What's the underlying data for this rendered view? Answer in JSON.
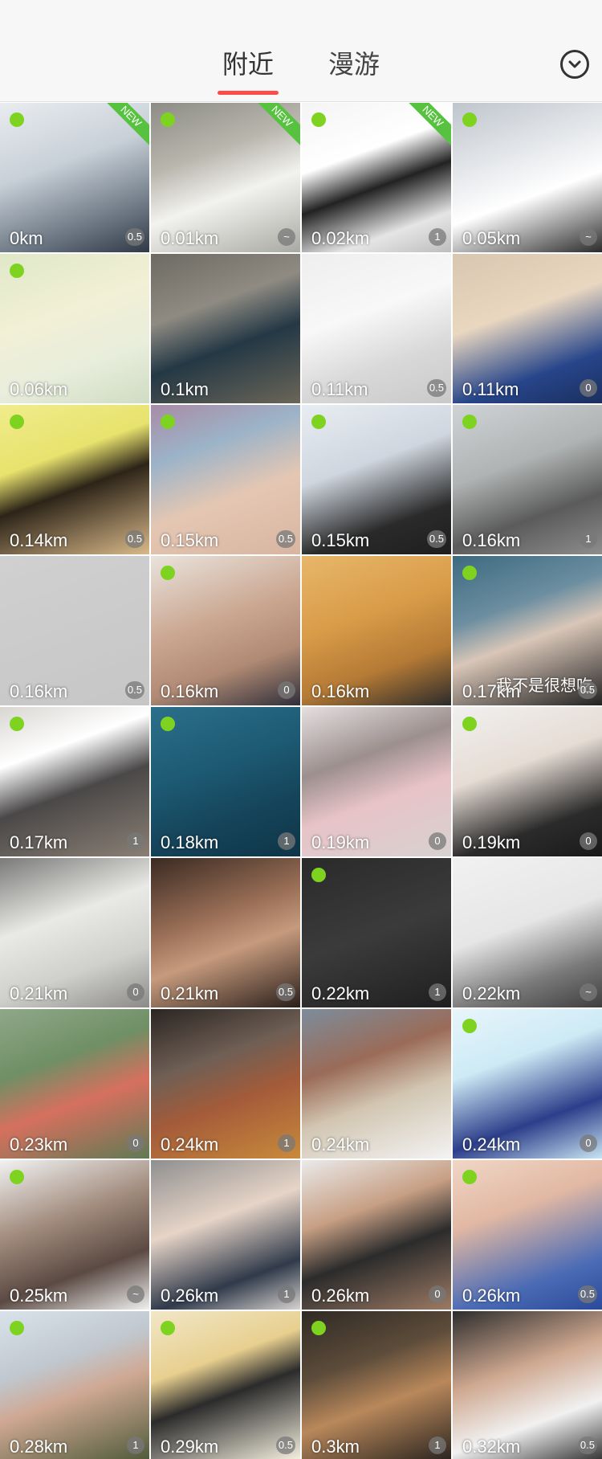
{
  "header": {
    "tabs": [
      {
        "label": "附近",
        "active": true
      },
      {
        "label": "漫游",
        "active": false
      }
    ],
    "dropdown_icon": "chevron-down-circle-icon"
  },
  "colors": {
    "online": "#7ed321",
    "new_tag": "#56c240",
    "tab_underline": "#ff4a4a"
  },
  "users": [
    {
      "distance": "0km",
      "badge": "0.5",
      "online": true,
      "new": true,
      "new_label": "NEW",
      "bg": "linear-gradient(160deg,#e9ecef 0%,#c8d0d8 40%,#6f7a86 75%,#2f3a46 100%)"
    },
    {
      "distance": "0.01km",
      "badge": "~",
      "online": true,
      "new": true,
      "new_label": "NEW",
      "bg": "linear-gradient(160deg,#8c8c86 0%,#b9b6ad 35%,#f2f2ef 60%,#a9a9a3 100%)"
    },
    {
      "distance": "0.02km",
      "badge": "1",
      "online": true,
      "new": true,
      "new_label": "NEW",
      "bg": "linear-gradient(160deg,#f4f4f4 0%,#ffffff 35%,#222 55%,#e5e5e5 80%,#bdbdbd 100%)"
    },
    {
      "distance": "0.05km",
      "badge": "~",
      "online": true,
      "new": false,
      "bg": "linear-gradient(160deg,#bfc5cc 0%,#e9ebee 40%,#ffffff 60%,#2b2b2b 100%)"
    },
    {
      "distance": "0.06km",
      "badge": "",
      "online": true,
      "new": false,
      "bg": "linear-gradient(160deg,#dfe8c8 0%,#f2f0d6 40%,#e8eddc 70%,#cfdcc2 100%)"
    },
    {
      "distance": "0.1km",
      "badge": "",
      "online": false,
      "new": false,
      "bg": "linear-gradient(160deg,#6d6a63 0%,#8f8b82 35%,#243845 60%,#6b6658 100%)"
    },
    {
      "distance": "0.11km",
      "badge": "0.5",
      "online": false,
      "new": false,
      "bg": "linear-gradient(160deg,#eeeeee 0%,#f8f8f8 40%,#d8d8d8 70%,#c9c9c9 100%)"
    },
    {
      "distance": "0.11km",
      "badge": "0",
      "online": false,
      "new": false,
      "bg": "linear-gradient(160deg,#d8c6b0 0%,#e9d7c0 40%,#27458a 75%,#1b2f5f 100%)"
    },
    {
      "distance": "0.14km",
      "badge": "0.5",
      "online": true,
      "new": false,
      "bg": "linear-gradient(160deg,#f0ec8a 0%,#e8e26e 35%,#2d2418 55%,#d9b98a 100%)"
    },
    {
      "distance": "0.15km",
      "badge": "0.5",
      "online": true,
      "new": false,
      "bg": "linear-gradient(160deg,#a88ca6 0%,#9cb3c8 30%,#e4c7b3 60%,#d8b5a0 100%)"
    },
    {
      "distance": "0.15km",
      "badge": "0.5",
      "online": true,
      "new": false,
      "bg": "linear-gradient(160deg,#e8edf2 0%,#cfd6df 40%,#2a2a2a 75%,#1e1e1e 100%)"
    },
    {
      "distance": "0.16km",
      "badge": "1",
      "online": true,
      "new": false,
      "bg": "linear-gradient(160deg,#cfd3d6 0%,#b0b3b3 40%,#5b5b5b 70%,#8d8d8d 100%)"
    },
    {
      "distance": "0.16km",
      "badge": "0.5",
      "online": false,
      "new": false,
      "bg": "linear-gradient(160deg,#d0d0d0 0%,#c6c6c6 100%)"
    },
    {
      "distance": "0.16km",
      "badge": "0",
      "online": true,
      "new": false,
      "bg": "linear-gradient(160deg,#e9e3dc 0%,#c9a48e 45%,#b08a74 70%,#2f2f3a 100%)"
    },
    {
      "distance": "0.16km",
      "badge": "",
      "online": false,
      "new": false,
      "bg": "linear-gradient(160deg,#e7b66a 0%,#d99c49 40%,#b57a35 70%,#2b2b2b 100%)"
    },
    {
      "distance": "0.17km",
      "badge": "0.5",
      "online": true,
      "new": false,
      "caption": "我不是很想吃",
      "bg": "linear-gradient(160deg,#3d6a80 0%,#6c8ea0 35%,#d9c6b8 55%,#222 100%)"
    },
    {
      "distance": "0.17km",
      "badge": "1",
      "online": true,
      "new": false,
      "bg": "linear-gradient(160deg,#d9d6d2 0%,#ffffff 30%,#4a4848 55%,#8a7f74 100%)"
    },
    {
      "distance": "0.18km",
      "badge": "1",
      "online": true,
      "new": false,
      "bg": "linear-gradient(160deg,#2c6f8a 0%,#1d5a73 40%,#15445a 70%,#0f3547 100%)"
    },
    {
      "distance": "0.19km",
      "badge": "0",
      "online": false,
      "new": false,
      "bg": "linear-gradient(160deg,#e5dfe0 0%,#9c8f8e 35%,#e7c3c7 60%,#d8d1d1 100%)"
    },
    {
      "distance": "0.19km",
      "badge": "0",
      "online": true,
      "new": false,
      "bg": "linear-gradient(160deg,#f0f0ef 0%,#e6dcd4 40%,#2b2b2b 75%,#1a1a1a 100%)"
    },
    {
      "distance": "0.21km",
      "badge": "0",
      "online": false,
      "new": false,
      "bg": "linear-gradient(160deg,#7a7a78 0%,#e9e9e6 40%,#cfcfcc 70%,#8b8a86 100%)"
    },
    {
      "distance": "0.21km",
      "badge": "0.5",
      "online": false,
      "new": false,
      "bg": "linear-gradient(160deg,#3a2a22 0%,#9a6f57 40%,#c69a7d 60%,#2a1f1a 100%)"
    },
    {
      "distance": "0.22km",
      "badge": "1",
      "online": true,
      "new": false,
      "bg": "linear-gradient(160deg,#2a2a2a 0%,#3b3b3b 50%,#1f1f1f 100%)"
    },
    {
      "distance": "0.22km",
      "badge": "~",
      "online": false,
      "new": false,
      "bg": "linear-gradient(160deg,#f1f1f1 0%,#e6e6e6 45%,#7a7a7a 75%,#3e3e3e 100%)"
    },
    {
      "distance": "0.23km",
      "badge": "0",
      "online": false,
      "new": false,
      "bg": "linear-gradient(160deg,#8fa889 0%,#6f8f65 35%,#d6705e 60%,#5f7a55 100%)"
    },
    {
      "distance": "0.24km",
      "badge": "1",
      "online": false,
      "new": false,
      "bg": "linear-gradient(160deg,#2b2522 0%,#6f5f55 35%,#a35b3a 60%,#c98a3b 100%)"
    },
    {
      "distance": "0.24km",
      "badge": "",
      "online": false,
      "new": false,
      "bg": "linear-gradient(160deg,#7c8d9b 0%,#9a6b58 35%,#d2c6b2 60%,#f3f3f3 100%)"
    },
    {
      "distance": "0.24km",
      "badge": "0",
      "online": true,
      "new": false,
      "bg": "linear-gradient(160deg,#e8f5fb 0%,#cdeaf5 35%,#2c3e8a 70%,#c8e4f2 100%)"
    },
    {
      "distance": "0.25km",
      "badge": "~",
      "online": true,
      "new": false,
      "bg": "linear-gradient(160deg,#f2f2f2 0%,#a08a7c 40%,#5b4a43 70%,#f0f0f0 100%)"
    },
    {
      "distance": "0.26km",
      "badge": "1",
      "online": false,
      "new": false,
      "bg": "linear-gradient(160deg,#8f8f8f 0%,#e6d4c7 40%,#303a4a 75%,#d6d2cf 100%)"
    },
    {
      "distance": "0.26km",
      "badge": "0",
      "online": false,
      "new": false,
      "bg": "linear-gradient(160deg,#eaeaea 0%,#c79f84 35%,#2b2b2b 60%,#9c7a64 100%)"
    },
    {
      "distance": "0.26km",
      "badge": "0.5",
      "online": true,
      "new": false,
      "bg": "linear-gradient(160deg,#f0d6c6 0%,#e1b8a3 35%,#4b6bb5 75%,#2b4a9a 100%)"
    },
    {
      "distance": "0.28km",
      "badge": "1",
      "online": true,
      "new": false,
      "bg": "linear-gradient(160deg,#d9e2ea 0%,#c0c7ce 35%,#cfa893 55%,#4f5a3a 100%)"
    },
    {
      "distance": "0.29km",
      "badge": "0.5",
      "online": true,
      "new": false,
      "bg": "linear-gradient(160deg,#f1e7c7 0%,#e7cf8f 35%,#2b2b2b 55%,#f6f1e0 100%)"
    },
    {
      "distance": "0.3km",
      "badge": "1",
      "online": true,
      "new": false,
      "bg": "linear-gradient(160deg,#2f2a25 0%,#5d4c3a 35%,#b9885b 60%,#2a241f 100%)"
    },
    {
      "distance": "0.32km",
      "badge": "0.5",
      "online": false,
      "new": false,
      "bg": "linear-gradient(160deg,#2d2d2d 0%,#cfa890 40%,#f1f1f1 70%,#333 100%)"
    }
  ]
}
